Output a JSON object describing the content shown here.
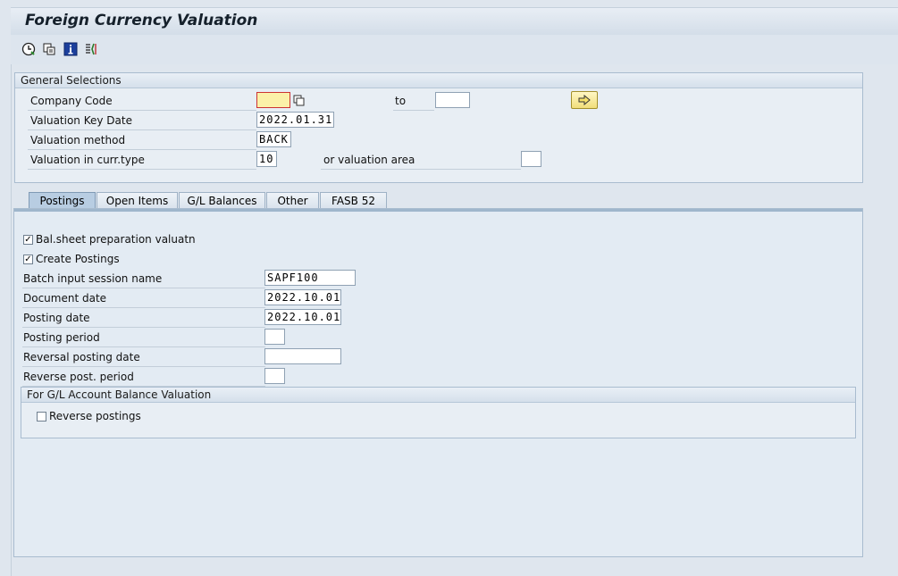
{
  "window": {
    "title": "Foreign Currency Valuation"
  },
  "toolbar": {
    "icons": [
      "execute-icon",
      "copy-variant-icon",
      "info-icon",
      "get-variant-icon"
    ]
  },
  "general_selections": {
    "title": "General Selections",
    "company_code_label": "Company Code",
    "company_code_value": "",
    "to_label": "to",
    "company_code_to_value": "",
    "key_date_label": "Valuation Key Date",
    "key_date_value": "2022.01.31",
    "method_label": "Valuation method",
    "method_value": "BACK",
    "curr_type_label": "Valuation in curr.type",
    "curr_type_value": "10",
    "valuation_area_label": "or valuation area",
    "valuation_area_value": ""
  },
  "tabs": [
    {
      "label": "Postings",
      "active": true
    },
    {
      "label": "Open Items",
      "active": false
    },
    {
      "label": "G/L Balances",
      "active": false
    },
    {
      "label": "Other",
      "active": false
    },
    {
      "label": "FASB 52",
      "active": false
    }
  ],
  "postings": {
    "bal_sheet_label": "Bal.sheet preparation valuatn",
    "bal_sheet_checked": true,
    "create_postings_label": "Create Postings",
    "create_postings_checked": true,
    "batch_label": "Batch input session name",
    "batch_value": "SAPF100",
    "doc_date_label": "Document date",
    "doc_date_value": "2022.10.01",
    "post_date_label": "Posting date",
    "post_date_value": "2022.10.01",
    "period_label": "Posting period",
    "period_value": "",
    "rev_date_label": "Reversal posting date",
    "rev_date_value": "",
    "rev_period_label": "Reverse post. period",
    "rev_period_value": "",
    "gl_group_title": "For G/L Account Balance Valuation",
    "reverse_label": "Reverse postings",
    "reverse_checked": false
  },
  "colors": {
    "accent": "#b8cde2",
    "required_field": "#fbf1a8",
    "required_border": "#cc3333"
  }
}
